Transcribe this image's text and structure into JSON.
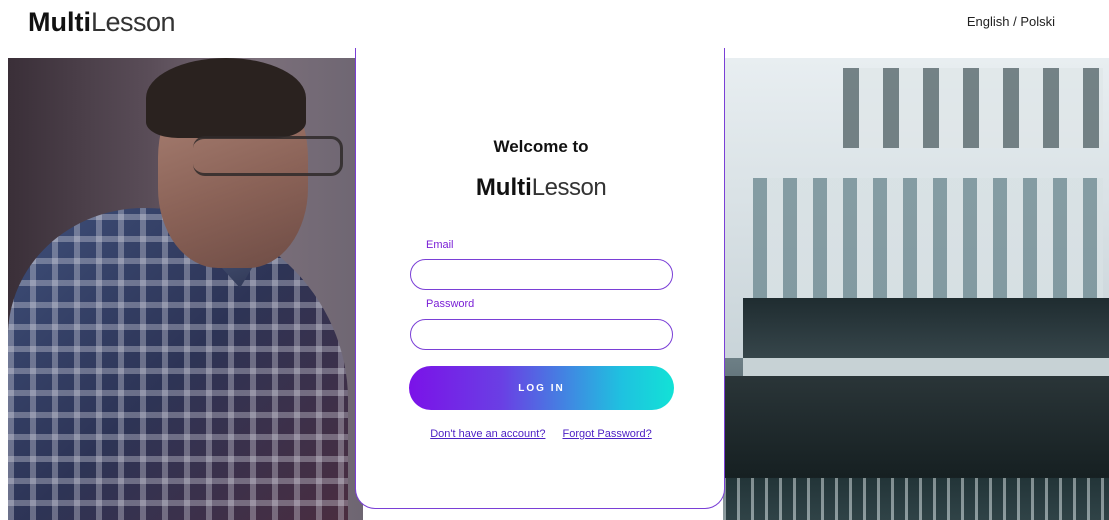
{
  "header": {
    "logo_bold": "Multi",
    "logo_light": "Lesson",
    "language_link": "English / Polski"
  },
  "card": {
    "welcome": "Welcome to",
    "logo_bold": "Multi",
    "logo_light": "Lesson",
    "email_label": "Email",
    "email_value": "",
    "password_label": "Password",
    "password_value": "",
    "login_button": "LOG IN",
    "signup_link": "Don't have an account?",
    "forgot_link": "Forgot Password?"
  },
  "colors": {
    "accent_purple": "#7a3fd6",
    "gradient_start": "#7b12e8",
    "gradient_end": "#12e2d6"
  },
  "images": {
    "left_background": "man in plaid shirt smiling",
    "right_background": "city building storefront"
  }
}
